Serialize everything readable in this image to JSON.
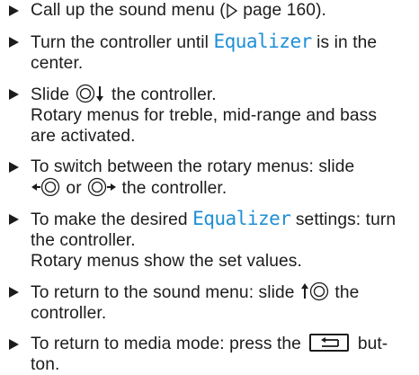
{
  "steps": [
    {
      "a": "Call up the sound menu (",
      "page_ref_icon": "triangle-right-outline-icon",
      "b": "page 160)."
    },
    {
      "a": "Turn the controller until ",
      "display_word": "Equalizer",
      "b": " is in the",
      "c": "center."
    },
    {
      "a": "Slide ",
      "controller_icon": "controller-slide-down-icon",
      "b": " the controller.",
      "result": "Rotary menus for treble, mid-range and bass",
      "result2": "are activated."
    },
    {
      "a": "To switch between the rotary menus: slide",
      "controller_icon_left": "controller-slide-left-icon",
      "or": " or ",
      "controller_icon_right": "controller-slide-right-icon",
      "b": " the controller."
    },
    {
      "a": "To make the desired ",
      "display_word": "Equalizer",
      "b": " settings: turn",
      "c": "the controller.",
      "result": "Rotary menus show the set values."
    },
    {
      "a": "To return to the sound menu: slide ",
      "controller_icon": "controller-slide-up-icon",
      "b": " the",
      "c": "controller."
    },
    {
      "a": "To return to media mode: press the ",
      "button_icon": "back-button-icon",
      "b": " but-",
      "c": "ton."
    }
  ],
  "colors": {
    "text": "#1c1c1c",
    "display_text": "#1e8fd6"
  }
}
